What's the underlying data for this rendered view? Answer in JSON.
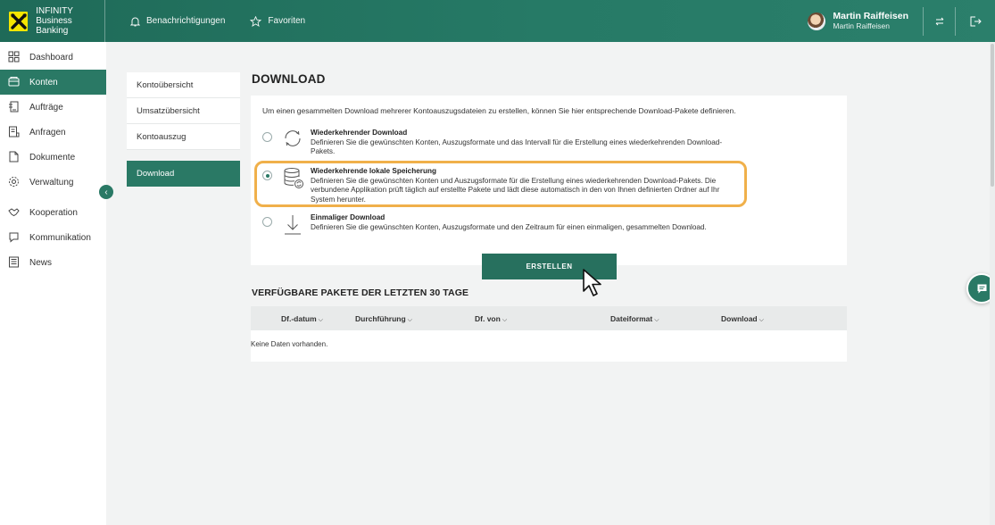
{
  "header": {
    "brand_line1": "INFINITY",
    "brand_line2": "Business Banking",
    "notifications": "Benachrichtigungen",
    "favorites": "Favoriten",
    "user_name": "Martin Raiffeisen",
    "user_company": "Martin Raiffeisen",
    "colors": {
      "header_bg": "#267a66",
      "logo_yellow": "#f5e500"
    }
  },
  "sidebar": {
    "items": [
      {
        "label": "Dashboard",
        "icon": "dashboard-icon"
      },
      {
        "label": "Konten",
        "icon": "wallet-icon"
      },
      {
        "label": "Aufträge",
        "icon": "orders-icon"
      },
      {
        "label": "Anfragen",
        "icon": "request-icon"
      },
      {
        "label": "Dokumente",
        "icon": "document-icon"
      },
      {
        "label": "Verwaltung",
        "icon": "gear-icon"
      },
      {
        "label": "Kooperation",
        "icon": "handshake-icon"
      },
      {
        "label": "Kommunikation",
        "icon": "chat-icon"
      },
      {
        "label": "News",
        "icon": "news-icon"
      }
    ],
    "active": "Konten",
    "collapse_glyph": "‹"
  },
  "submenu": {
    "items": [
      "Kontoübersicht",
      "Umsatzübersicht",
      "Kontoauszug"
    ],
    "download": "Download"
  },
  "main": {
    "title": "DOWNLOAD",
    "intro": "Um einen gesammelten Download mehrerer Kontoauszugsdateien zu erstellen, können Sie hier entsprechende Download-Pakete definieren.",
    "options": [
      {
        "title": "Wiederkehrender Download",
        "desc": "Definieren Sie die gewünschten Konten, Auszugsformate und das Intervall für die Erstellung eines wiederkehrenden Download-Pakets.",
        "selected": false
      },
      {
        "title": "Wiederkehrende lokale Speicherung",
        "desc": "Definieren Sie die gewünschten Konten und Auszugsformate für die Erstellung eines wiederkehrenden Download-Pakets. Die verbundene Applikation prüft täglich auf erstellte Pakete und lädt diese automatisch in den von Ihnen definierten Ordner auf Ihr System herunter.",
        "selected": true
      },
      {
        "title": "Einmaliger Download",
        "desc": "Definieren Sie die gewünschten Konten, Auszugsformate und den Zeitraum für einen einmaligen, gesammelten Download.",
        "selected": false
      }
    ],
    "create_button": "ERSTELLEN",
    "highlight_color": "#f0b04a"
  },
  "packages": {
    "title": "VERFÜGBARE PAKETE DER LETZTEN 30 TAGE",
    "columns": [
      "Df.-datum",
      "Durchführung",
      "Df. von",
      "Dateiformat",
      "Download"
    ],
    "chevron": "⌵",
    "empty": "Keine Daten vorhanden."
  }
}
